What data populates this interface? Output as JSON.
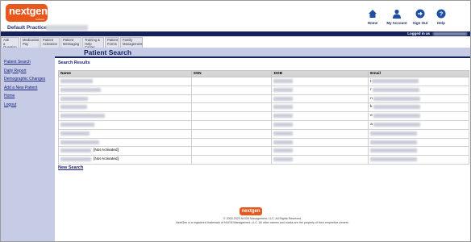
{
  "brand": {
    "logo_text": "nextgen",
    "logo_sub": "healthcare",
    "practice": "Default Practice"
  },
  "top_nav": [
    {
      "label": "Home",
      "icon": "home-icon"
    },
    {
      "label": "My Account",
      "icon": "user-icon"
    },
    {
      "label": "Sign Out",
      "icon": "sign-out-icon"
    },
    {
      "label": "Help",
      "icon": "help-icon"
    }
  ],
  "logged_in_label": "Logged in as",
  "tabs": [
    {
      "line1": "Ask",
      "line2": "a Question"
    },
    {
      "line1": "Medication",
      "line2": "Pay"
    },
    {
      "line1": "Patient",
      "line2": "Activation"
    },
    {
      "line1": "Patient",
      "line2": "Messaging"
    },
    {
      "line1": "Training &",
      "line2": "Help Center"
    },
    {
      "line1": "Patient",
      "line2": "Forms"
    },
    {
      "line1": "Family",
      "line2": "Management"
    }
  ],
  "sidebar": [
    "Patient Search",
    "Daily Report",
    "Demographic Changes",
    "Add a New Patient",
    "Home",
    "Logout"
  ],
  "page_title": "Patient Search",
  "results_label": "Search Results",
  "table": {
    "columns": [
      "Name",
      "SSN",
      "DOB",
      "Email"
    ],
    "rows": [
      {
        "status": "",
        "email_initial": "j"
      },
      {
        "status": "",
        "email_initial": "r"
      },
      {
        "status": "",
        "email_initial": "n"
      },
      {
        "status": "",
        "email_initial": "k"
      },
      {
        "status": "",
        "email_initial": "e"
      },
      {
        "status": "",
        "email_initial": "a"
      },
      {
        "status": "",
        "email_initial": ""
      },
      {
        "status": "",
        "email_initial": ""
      },
      {
        "status": "[Not Activated]",
        "email_initial": ""
      },
      {
        "status": "[Not Activated]",
        "email_initial": ""
      }
    ]
  },
  "new_search": "New Search",
  "footer": {
    "logo_text": "nextgen",
    "copyright": "© 2000-2023 NXGN Management, LLC. All Rights Reserved.",
    "trademark": "NextGen is a registered trademark of NXGN Management, LLC. All other names and marks are the property of their respective owners."
  },
  "colors": {
    "brand_orange": "#e8581c",
    "navy": "#14215c",
    "sidebar": "#c6cbe6",
    "link": "#1a237e"
  }
}
